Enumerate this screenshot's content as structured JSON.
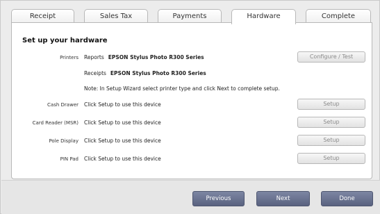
{
  "tabs": [
    {
      "label": "Receipt"
    },
    {
      "label": "Sales Tax"
    },
    {
      "label": "Payments"
    },
    {
      "label": "Hardware",
      "active": true
    },
    {
      "label": "Complete"
    }
  ],
  "section_title": "Set up your hardware",
  "printers": {
    "label": "Printers",
    "reports_label": "Reports",
    "reports_value": "EPSON Stylus Photo R300 Series",
    "receipts_label": "Receipts",
    "receipts_value": "EPSON Stylus Photo R300 Series",
    "note": "Note: In Setup Wizard select printer type and click Next to complete setup.",
    "configure_button": "Configure / Test"
  },
  "devices": [
    {
      "label": "Cash Drawer",
      "status": "Click Setup to use this device",
      "button": "Setup"
    },
    {
      "label": "Card Reader (MSR)",
      "status": "Click Setup to use this device",
      "button": "Setup"
    },
    {
      "label": "Pole Display",
      "status": "Click Setup to use this device",
      "button": "Setup"
    },
    {
      "label": "PIN Pad",
      "status": "Click Setup to use this device",
      "button": "Setup"
    }
  ],
  "footer": {
    "previous": "Previous",
    "next": "Next",
    "done": "Done"
  }
}
